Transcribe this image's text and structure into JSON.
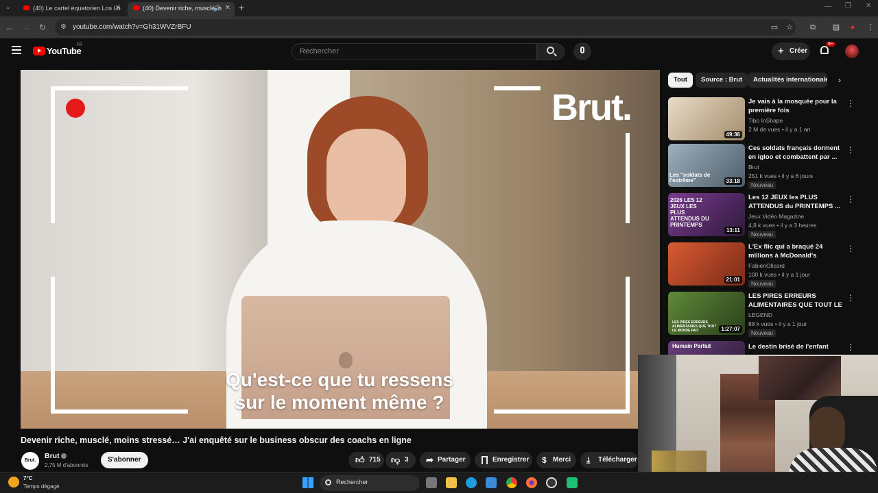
{
  "browser": {
    "tabs": [
      {
        "title": "(40) Le cartel équatorien Los Lo",
        "active": false
      },
      {
        "title": "(40) Devenir riche, musclé, n",
        "active": true
      }
    ],
    "url": "youtube.com/watch?v=Gh31WVZrBFU"
  },
  "youtube": {
    "logo_text": "YouTube",
    "logo_region": "FR",
    "search_placeholder": "Rechercher",
    "create_label": "Créer",
    "notif_badge": "9+"
  },
  "video": {
    "overlay_brand": "Brut.",
    "subtitle_line1": "Qu'est-ce que tu ressens",
    "subtitle_line2": "sur le moment même ?",
    "title": "Devenir riche, musclé, moins stressé… J'ai enquêté sur le business obscur des coachs en ligne",
    "channel_avatar": "Brut.",
    "channel_name": "Brut",
    "subscribers": "2,75 M d'abonnés",
    "subscribe_label": "S'abonner",
    "likes": "715",
    "dislikes": "3",
    "share_label": "Partager",
    "save_label": "Enregistrer",
    "thanks_label": "Merci",
    "download_label": "Télécharger"
  },
  "sidebar": {
    "chips": [
      "Tout",
      "Source : Brut",
      "Actualités internationales"
    ],
    "recommendations": [
      {
        "title": "Je vais à la mosquée pour la première fois",
        "channel": "Tibo InShape",
        "meta": "2 M de vues • il y a 1 an",
        "duration": "49:36",
        "new": "",
        "thumb_color": "#c8b59a"
      },
      {
        "title": "Ces soldats français dorment en igloo et combattent par ...",
        "channel": "Brut",
        "meta": "251 k vues • il y a 6 jours",
        "duration": "33:18",
        "new": "Nouveau",
        "thumb_color": "#6f7f8c",
        "thumb_text": "Les \"soldats de l'extrême\""
      },
      {
        "title": "Les 12 JEUX les PLUS ATTENDUS du PRINTEMPS ...",
        "channel": "Jeux Vidéo Magazine",
        "meta": "4,8 k vues • il y a 3 heures",
        "duration": "13:11",
        "new": "Nouveau",
        "thumb_color": "#5a2d6e",
        "thumb_text": "2026 LES 12 JEUX LES PLUS ATTENDUS DU PRINTEMPS"
      },
      {
        "title": "L'Ex flic qui a braqué 24 millions à McDonald's (L'arnaque du ...",
        "channel": "FabienOlicard",
        "meta": "100 k vues • il y a 1 jour",
        "duration": "21:01",
        "new": "Nouveau",
        "thumb_color": "#b8462a"
      },
      {
        "title": "LES PIRES ERREURS ALIMENTAIRES QUE TOUT LE ...",
        "channel": "LEGEND",
        "meta": "88 k vues • il y a 1 jour",
        "duration": "1:27:07",
        "new": "Nouveau",
        "thumb_color": "#3f5e2a",
        "thumb_text": "LES PIRES ERREURS ALIMENTAIRES QUE TOUT LE MONDE FAIT"
      },
      {
        "title": "Le destin brisé de l'enfant",
        "channel": "",
        "meta": "",
        "duration": "",
        "new": "",
        "thumb_color": "#4a2f5c",
        "thumb_text": "Humain Parfait"
      }
    ]
  },
  "taskbar": {
    "weather_temp": "7°C",
    "weather_desc": "Temps dégagé",
    "search_label": "Rechercher"
  }
}
